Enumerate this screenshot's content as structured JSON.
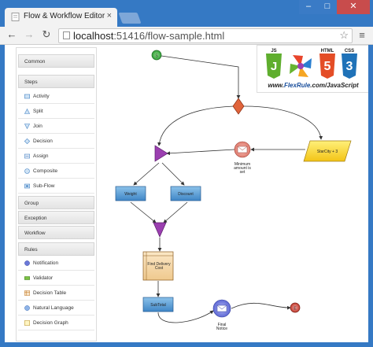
{
  "browser": {
    "tab_title": "Flow & Workflow Editor",
    "tab_close": "×",
    "url_host": "localhost",
    "url_path": ":51416/flow-sample.html",
    "window_buttons": {
      "minimize": "–",
      "maximize": "□",
      "close": "✕"
    },
    "nav": {
      "back": "←",
      "forward": "→",
      "reload": "↻",
      "bookmark": "☆",
      "menu": "≡"
    }
  },
  "sidebar": {
    "sections": [
      {
        "label": "Common"
      },
      {
        "label": "Steps",
        "items": [
          {
            "label": "Activity",
            "icon": "activity-icon"
          },
          {
            "label": "Split",
            "icon": "split-icon"
          },
          {
            "label": "Join",
            "icon": "join-icon"
          },
          {
            "label": "Decision",
            "icon": "decision-icon"
          },
          {
            "label": "Assign",
            "icon": "assign-icon"
          },
          {
            "label": "Composite",
            "icon": "composite-icon"
          },
          {
            "label": "Sub-Flow",
            "icon": "subflow-icon"
          }
        ]
      },
      {
        "label": "Group"
      },
      {
        "label": "Exception"
      },
      {
        "label": "Workflow"
      },
      {
        "label": "Rules",
        "items": [
          {
            "label": "Notification",
            "icon": "notification-icon"
          },
          {
            "label": "Validator",
            "icon": "validator-icon"
          },
          {
            "label": "Decision Table",
            "icon": "decision-table-icon"
          },
          {
            "label": "Natural Language",
            "icon": "natural-language-icon"
          },
          {
            "label": "Decision Graph",
            "icon": "decision-graph-icon"
          }
        ]
      }
    ]
  },
  "logo": {
    "badges": [
      "JS",
      "HTML",
      "CSS"
    ],
    "caption_prefix": "www.",
    "caption_brand": "FlexRule",
    "caption_suffix": ".com/JavaScript"
  },
  "flow": {
    "start_label": "S",
    "end_label": "E",
    "nodes": {
      "star_city": "StarCity + 3",
      "minimum_line1": "Minimum",
      "minimum_line2": "amount is",
      "minimum_line3": "set",
      "weight": "Weight",
      "discount": "Discount",
      "find_delivery_line1": "Find Delivery",
      "find_delivery_line2": "Cost",
      "subtotal": "SubTotal",
      "final_line1": "Final",
      "final_line2": "Notice"
    }
  },
  "colors": {
    "titlebar": "#3579c4",
    "activity_fill": "#5a9fd4",
    "decision_fill": "#e0643b",
    "assign_fill": "#ffd72e",
    "split_fill": "#9b3fb0",
    "start_fill": "#3cb043",
    "end_fill": "#d9534f"
  }
}
